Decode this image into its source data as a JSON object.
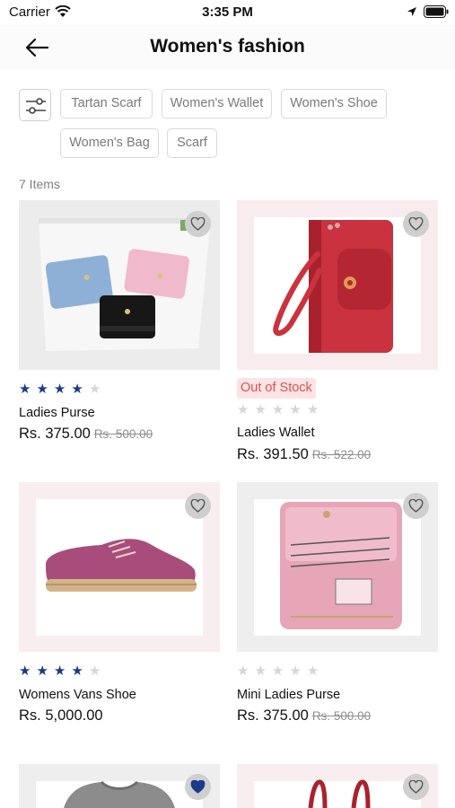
{
  "status": {
    "carrier": "Carrier",
    "time": "3:35 PM"
  },
  "header": {
    "title": "Women's fashion"
  },
  "filters": {
    "chips": [
      "Tartan Scarf",
      "Women's Wallet",
      "Women's Shoe",
      "Women's Bag",
      "Scarf"
    ]
  },
  "summary": {
    "item_count": "7 Items"
  },
  "colors": {
    "star_active": "#1a3a8a",
    "out_of_stock_bg": "#fde4e4",
    "out_of_stock_text": "#d9534f",
    "wishlist_active": "#1a3a8a"
  },
  "products": [
    {
      "name": "Ladies Purse",
      "price": "Rs. 375.00",
      "old_price": "Rs. 500.00",
      "rating": 4,
      "status": "",
      "wishlisted": false,
      "image": "wallets-purse-image"
    },
    {
      "name": "Ladies Wallet",
      "price": "Rs. 391.50",
      "old_price": "Rs. 522.00",
      "rating": 0,
      "status": "Out of Stock",
      "wishlisted": false,
      "image": "red-wallet-image"
    },
    {
      "name": "Womens Vans Shoe",
      "price": "Rs. 5,000.00",
      "old_price": "",
      "rating": 4,
      "status": "",
      "wishlisted": false,
      "image": "pink-shoe-image"
    },
    {
      "name": "Mini Ladies Purse",
      "price": "Rs. 375.00",
      "old_price": "Rs. 500.00",
      "rating": 0,
      "status": "",
      "wishlisted": false,
      "image": "pink-purse-image"
    },
    {
      "name": "",
      "price": "",
      "old_price": "",
      "rating": 0,
      "status": "",
      "wishlisted": true,
      "image": "grey-sweater-image"
    },
    {
      "name": "",
      "price": "",
      "old_price": "",
      "rating": 0,
      "status": "",
      "wishlisted": false,
      "image": "red-handbag-image"
    }
  ]
}
